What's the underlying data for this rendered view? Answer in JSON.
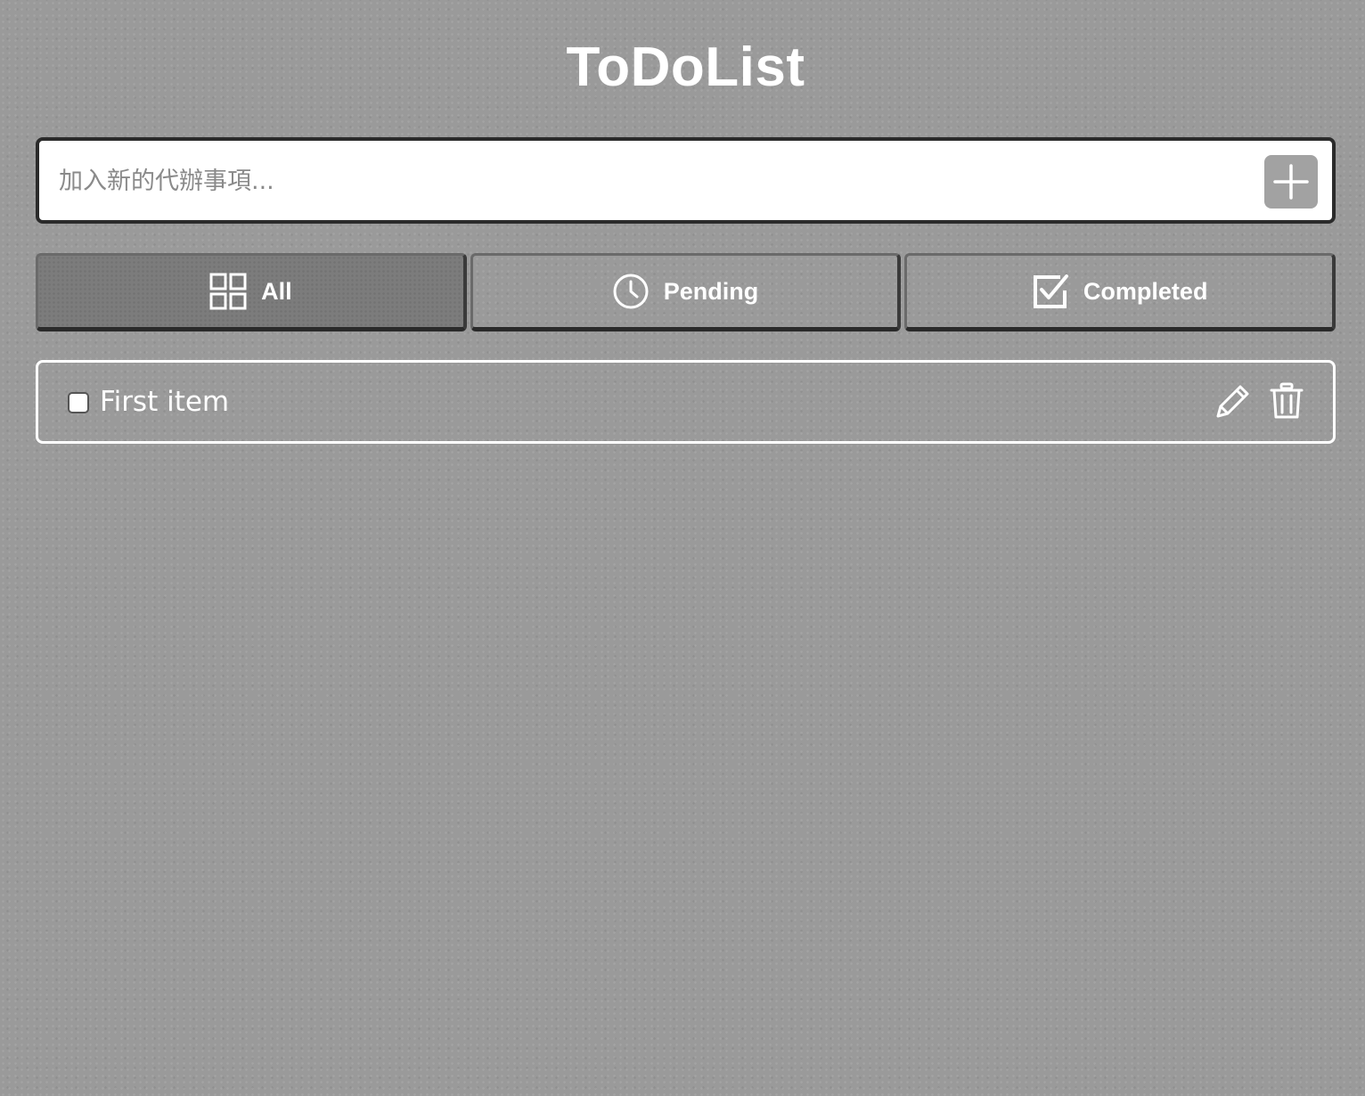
{
  "app": {
    "title": "ToDoList"
  },
  "new_todo": {
    "placeholder": "加入新的代辦事項...",
    "value": "",
    "add_icon": "plus-icon"
  },
  "filters": [
    {
      "label": "All",
      "icon": "grid-icon",
      "active": true
    },
    {
      "label": "Pending",
      "icon": "clock-icon",
      "active": false
    },
    {
      "label": "Completed",
      "icon": "checkbox-checked-icon",
      "active": false
    }
  ],
  "todos": [
    {
      "text": "First item",
      "completed": false,
      "edit_icon": "pencil-icon",
      "delete_icon": "trash-icon"
    }
  ],
  "colors": {
    "background": "#9a9a9a",
    "active_tab": "#7c7c7c",
    "add_button": "#a2a2a2",
    "text": "#ffffff"
  }
}
